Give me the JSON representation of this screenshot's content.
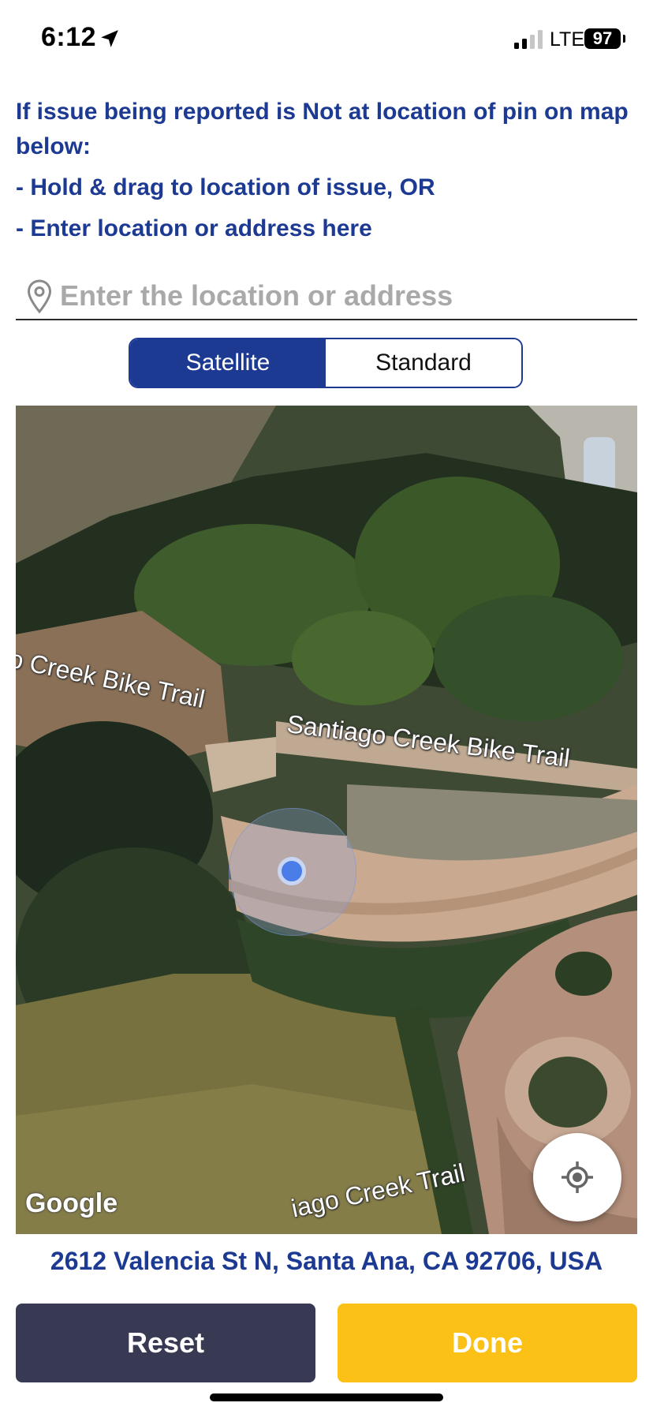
{
  "status_bar": {
    "time": "6:12",
    "network": "LTE",
    "battery": "97",
    "location_icon": "location-arrow-icon",
    "signal_icon": "cellular-signal-icon"
  },
  "instructions": {
    "line1": "If issue being reported is Not at location of pin on map below:",
    "line2": "- Hold & drag to location of issue, OR",
    "line3": "- Enter location or address here"
  },
  "search": {
    "placeholder": "Enter the location or address",
    "value": "",
    "icon": "map-pin-icon"
  },
  "map_type": {
    "options": [
      "Satellite",
      "Standard"
    ],
    "selected": "Satellite"
  },
  "map": {
    "labels": {
      "trail_left": "o Creek Bike Trail",
      "trail_main": "Santiago Creek Bike Trail",
      "trail_bottom": "iago Creek Trail"
    },
    "attribution": "Google",
    "locate_icon": "my-location-icon"
  },
  "address": "2612 Valencia St N, Santa Ana, CA 92706, USA",
  "buttons": {
    "reset": "Reset",
    "done": "Done"
  },
  "colors": {
    "primary": "#1d3a93",
    "done_button": "#fcc117",
    "reset_button": "#373a52"
  }
}
